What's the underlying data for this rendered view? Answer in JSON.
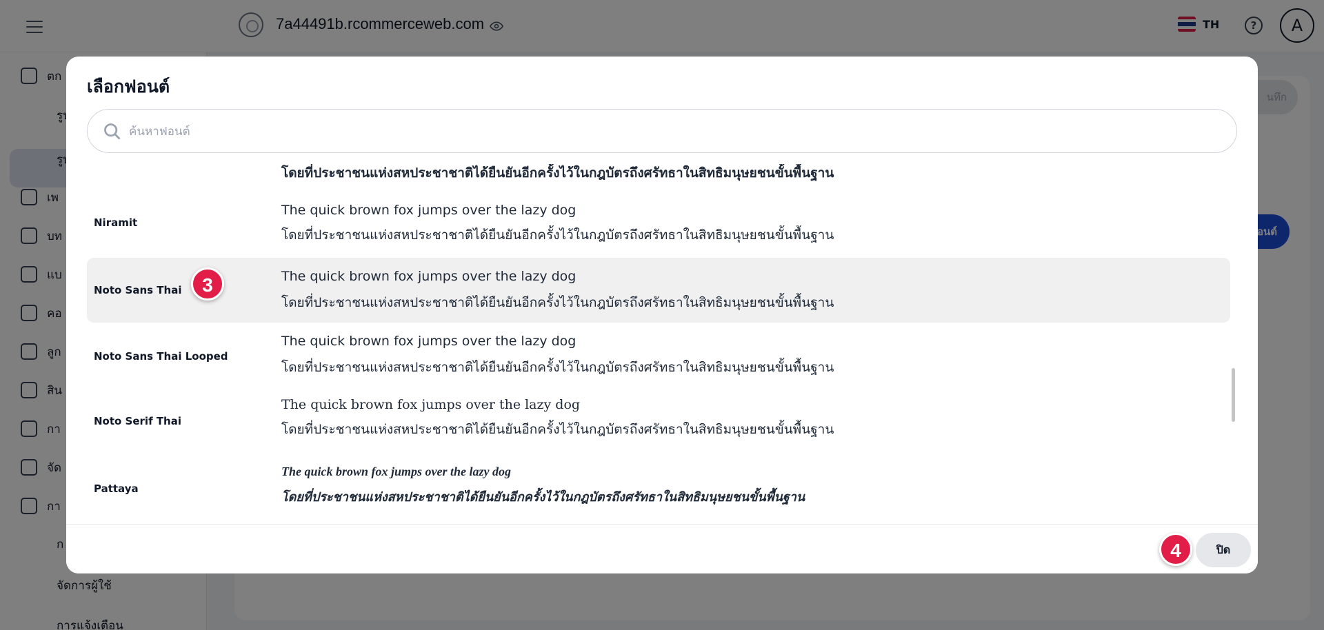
{
  "app": {
    "store_name": "7a44491b.rcommerceweb.com",
    "language": "TH",
    "help_symbol": "?",
    "avatar_initial": "A",
    "flag_colors": [
      "#e11d48",
      "#ffffff",
      "#1e3a8a",
      "#ffffff",
      "#e11d48"
    ]
  },
  "sidebar": {
    "items": [
      {
        "label": "ตก",
        "icon": "paint-bucket-icon"
      },
      {
        "label": "รูป",
        "icon": ""
      },
      {
        "label": "รูป",
        "icon": ""
      },
      {
        "label": "เพ",
        "icon": "document-icon"
      },
      {
        "label": "บท",
        "icon": "edit-list-icon"
      },
      {
        "label": "แบ",
        "icon": "clipboard-icon"
      },
      {
        "label": "คอ",
        "icon": "box-icon"
      },
      {
        "label": "ลูก",
        "icon": "users-icon"
      },
      {
        "label": "สิน",
        "icon": "archive-icon"
      },
      {
        "label": "กา",
        "icon": "store-icon"
      },
      {
        "label": "จัด",
        "icon": "cart-icon"
      },
      {
        "label": "กา",
        "icon": "gear-icon"
      }
    ],
    "sub_items": [
      "ก",
      "จัดการผู้ใช้",
      "การแจ้งเตือน"
    ]
  },
  "background_buttons": {
    "save_label": "นทึก",
    "add_font_label": "อนต์"
  },
  "modal": {
    "title": "เลือกฟอนต์",
    "search_placeholder": "ค้นหาฟอนต์",
    "partial_row_th": "โดยที่ประชาชนแห่งสหประชาชาติได้ยืนยันอีกครั้งไว้ในกฎบัตรถึงศรัทธาในสิทธิมนุษยชนขั้นพื้นฐาน",
    "fonts": [
      {
        "name": "Niramit",
        "en": "The quick brown fox  jumps over the lazy dog",
        "th": "โดยที่ประชาชนแห่งสหประชาชาติได้ยืนยันอีกครั้งไว้ในกฎบัตรถึงศรัทธาในสิทธิมนุษยชนขั้นพื้นฐาน"
      },
      {
        "name": "Noto Sans Thai",
        "en": "The quick brown fox jumps over the lazy dog",
        "th": "โดยที่ประชาชนแห่งสหประชาชาติได้ยืนยันอีกครั้งไว้ในกฎบัตรถึงศรัทธาในสิทธิมนุษยชนขั้นพื้นฐาน",
        "selected": true
      },
      {
        "name": "Noto Sans Thai Looped",
        "en": "The quick brown fox jumps over the lazy dog",
        "th": "โดยที่ประชาชนแห่งสหประชาชาติได้ยืนยันอีกครั้งไว้ในกฎบัตรถึงศรัทธาในสิทธิมนุษยชนขั้นพื้นฐาน"
      },
      {
        "name": "Noto Serif Thai",
        "en": "The quick brown fox jumps over the lazy dog",
        "th": "โดยที่ประชาชนแห่งสหประชาชาติได้ยืนยันอีกครั้งไว้ในกฎบัตรถึงศรัทธาในสิทธิมนุษยชนขั้นพื้นฐาน"
      },
      {
        "name": "Pattaya",
        "en": "The quick brown fox jumps over the lazy dog",
        "th": "โดยที่ประชาชนแห่งสหประชาชาติได้ยืนยันอีกครั้งไว้ในกฎบัตรถึงศรัทธาในสิทธิมนุษยชนขั้นพื้นฐาน"
      }
    ],
    "close_label": "ปิด"
  },
  "annotations": {
    "step_a": "3",
    "step_b": "4",
    "badge_color": "#e11d48"
  }
}
